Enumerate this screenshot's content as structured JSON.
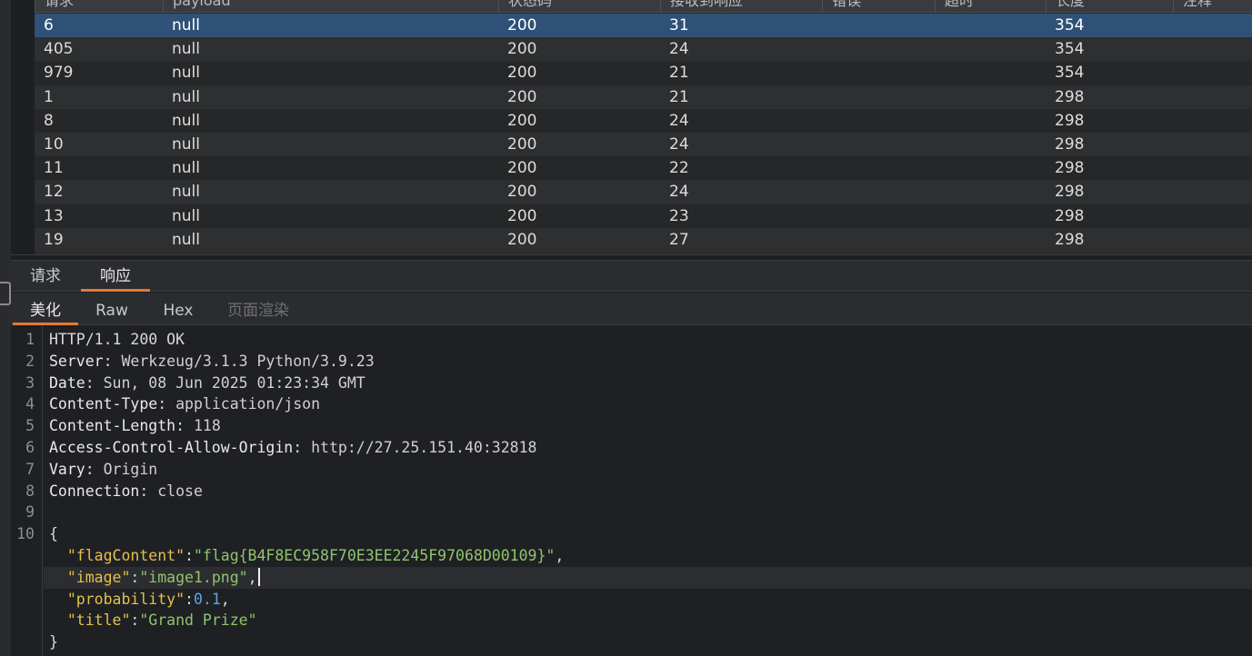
{
  "table": {
    "columns": [
      "请求",
      "payload",
      "状态码",
      "接收到响应",
      "错误",
      "超时",
      "长度",
      "注释"
    ],
    "rows": [
      {
        "request": "6",
        "payload": "null",
        "status": "200",
        "received": "31",
        "error": "",
        "timeout": "",
        "length": "354",
        "comment": "",
        "selected": true
      },
      {
        "request": "405",
        "payload": "null",
        "status": "200",
        "received": "24",
        "error": "",
        "timeout": "",
        "length": "354",
        "comment": ""
      },
      {
        "request": "979",
        "payload": "null",
        "status": "200",
        "received": "21",
        "error": "",
        "timeout": "",
        "length": "354",
        "comment": ""
      },
      {
        "request": "1",
        "payload": "null",
        "status": "200",
        "received": "21",
        "error": "",
        "timeout": "",
        "length": "298",
        "comment": ""
      },
      {
        "request": "8",
        "payload": "null",
        "status": "200",
        "received": "24",
        "error": "",
        "timeout": "",
        "length": "298",
        "comment": ""
      },
      {
        "request": "10",
        "payload": "null",
        "status": "200",
        "received": "24",
        "error": "",
        "timeout": "",
        "length": "298",
        "comment": ""
      },
      {
        "request": "11",
        "payload": "null",
        "status": "200",
        "received": "22",
        "error": "",
        "timeout": "",
        "length": "298",
        "comment": ""
      },
      {
        "request": "12",
        "payload": "null",
        "status": "200",
        "received": "24",
        "error": "",
        "timeout": "",
        "length": "298",
        "comment": ""
      },
      {
        "request": "13",
        "payload": "null",
        "status": "200",
        "received": "23",
        "error": "",
        "timeout": "",
        "length": "298",
        "comment": ""
      },
      {
        "request": "19",
        "payload": "null",
        "status": "200",
        "received": "27",
        "error": "",
        "timeout": "",
        "length": "298",
        "comment": ""
      }
    ]
  },
  "main_tabs": [
    {
      "label": "请求",
      "active": false
    },
    {
      "label": "响应",
      "active": true
    }
  ],
  "sub_tabs": [
    {
      "label": "美化",
      "active": true,
      "disabled": false
    },
    {
      "label": "Raw",
      "active": false,
      "disabled": false
    },
    {
      "label": "Hex",
      "active": false,
      "disabled": false
    },
    {
      "label": "页面渲染",
      "active": false,
      "disabled": true
    }
  ],
  "response": {
    "line_numbers": [
      "1",
      "2",
      "3",
      "4",
      "5",
      "6",
      "7",
      "8",
      "9",
      "10"
    ],
    "status_line": "HTTP/1.1 200 OK",
    "headers": [
      {
        "name": "Server",
        "value": "Werkzeug/3.1.3 Python/3.9.23"
      },
      {
        "name": "Date",
        "value": "Sun, 08 Jun 2025 01:23:34 GMT"
      },
      {
        "name": "Content-Type",
        "value": "application/json"
      },
      {
        "name": "Content-Length",
        "value": "118"
      },
      {
        "name": "Access-Control-Allow-Origin",
        "value": "http://27.25.151.40:32818"
      },
      {
        "name": "Vary",
        "value": "Origin"
      },
      {
        "name": "Connection",
        "value": "close"
      }
    ],
    "body": {
      "open_brace": "{",
      "close_brace": "}",
      "fields": [
        {
          "key": "\"flagContent\"",
          "value": "\"flag{B4F8EC958F70E3EE2245F97068D00109}\"",
          "type": "string",
          "trail": ","
        },
        {
          "key": "\"image\"",
          "value": "\"image1.png\"",
          "type": "string",
          "trail": ","
        },
        {
          "key": "\"probability\"",
          "value": "0.1",
          "type": "number",
          "trail": ","
        },
        {
          "key": "\"title\"",
          "value": "\"Grand Prize\"",
          "type": "string",
          "trail": ""
        }
      ]
    }
  },
  "colors": {
    "selected_row": "#2f5177",
    "tab_accent": "#e07b39",
    "json_key": "#e2c04a",
    "json_string": "#8fc46c",
    "json_number": "#5aa6e8"
  }
}
